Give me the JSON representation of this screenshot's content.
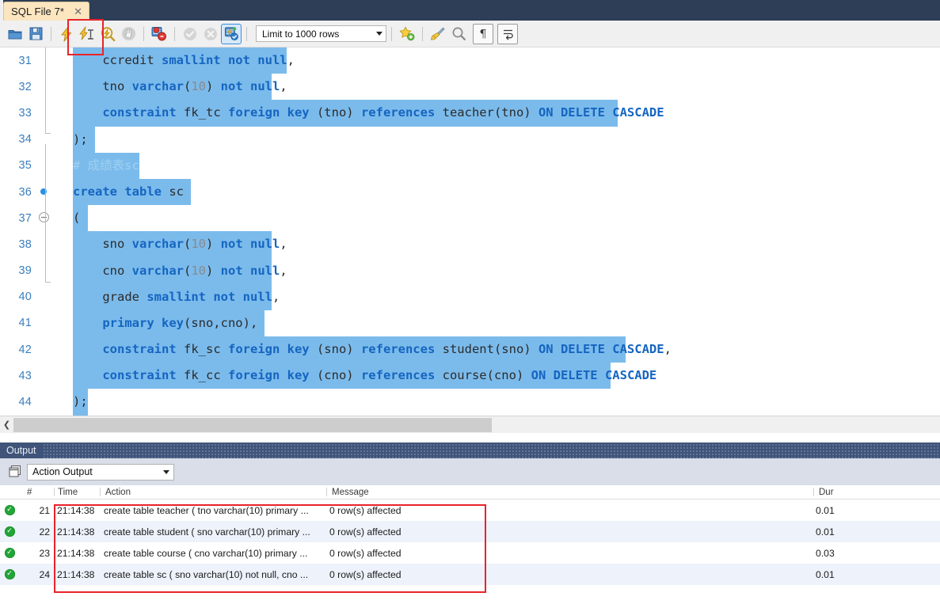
{
  "tab": {
    "label": "SQL File 7*",
    "close_icon": "close-icon"
  },
  "toolbar": {
    "items": [
      {
        "name": "open-sql-file-button",
        "icon": "folder-icon"
      },
      {
        "name": "save-sql-file-button",
        "icon": "floppy-disk-icon"
      },
      {
        "name": "execute-statement-button",
        "icon": "lightning-bolt-icon"
      },
      {
        "name": "execute-current-statement-button",
        "icon": "lightning-bolt-cursor-icon"
      },
      {
        "name": "explain-statement-button",
        "icon": "magnifier-lightning-icon"
      },
      {
        "name": "stop-execution-button",
        "icon": "stop-hand-icon"
      },
      {
        "name": "toggle-stop-on-error-button",
        "icon": "stop-on-error-icon"
      },
      {
        "name": "commit-button",
        "icon": "commit-check-icon"
      },
      {
        "name": "rollback-button",
        "icon": "rollback-cross-icon"
      },
      {
        "name": "toggle-autocommit-button",
        "icon": "autocommit-icon"
      },
      {
        "name": "beautify-query-button",
        "icon": "star-plus-icon"
      },
      {
        "name": "clear-query-button",
        "icon": "broom-icon"
      },
      {
        "name": "find-button",
        "icon": "magnifier-icon"
      },
      {
        "name": "toggle-invisible-chars-button",
        "icon": "pilcrow-icon"
      },
      {
        "name": "toggle-wrapping-button",
        "icon": "word-wrap-icon"
      }
    ],
    "limit_selector": {
      "label": "Limit to 1000 rows",
      "arrow_icon": "chevron-down-icon"
    }
  },
  "editor": {
    "lines": [
      {
        "num": "31",
        "indent": 4,
        "sel_start": 0,
        "sel_end": 29,
        "tokens": [
          {
            "t": "    ccredit ",
            "c": "plain"
          },
          {
            "t": "smallint not null",
            "c": "kw"
          },
          {
            "t": ",",
            "c": "plain"
          }
        ]
      },
      {
        "num": "32",
        "indent": 4,
        "sel_start": 0,
        "sel_end": 27,
        "tokens": [
          {
            "t": "    tno ",
            "c": "plain"
          },
          {
            "t": "varchar",
            "c": "kw"
          },
          {
            "t": "(",
            "c": "plain"
          },
          {
            "t": "10",
            "c": "num"
          },
          {
            "t": ") ",
            "c": "plain"
          },
          {
            "t": "not null",
            "c": "kw"
          },
          {
            "t": ",",
            "c": "plain"
          }
        ]
      },
      {
        "num": "33",
        "indent": 4,
        "sel_start": 0,
        "sel_end": 74,
        "tokens": [
          {
            "t": "    ",
            "c": "plain"
          },
          {
            "t": "constraint",
            "c": "kw"
          },
          {
            "t": " fk_tc ",
            "c": "plain"
          },
          {
            "t": "foreign key",
            "c": "kw"
          },
          {
            "t": " (tno) ",
            "c": "plain"
          },
          {
            "t": "references",
            "c": "kw"
          },
          {
            "t": " teacher(tno) ",
            "c": "plain"
          },
          {
            "t": "ON DELETE CASCADE",
            "c": "kw"
          }
        ]
      },
      {
        "num": "34",
        "indent": 0,
        "sel_start": 0,
        "sel_end": 3,
        "tokens": [
          {
            "t": ");",
            "c": "plain"
          }
        ]
      },
      {
        "num": "35",
        "indent": 0,
        "sel_start": 0,
        "sel_end": 9,
        "tokens": [
          {
            "t": "# 成绩表sc",
            "c": "cmt"
          }
        ]
      },
      {
        "num": "36",
        "indent": 0,
        "sel_start": 0,
        "sel_end": 16,
        "breakpoint": true,
        "tokens": [
          {
            "t": "create table",
            "c": "kw"
          },
          {
            "t": " sc",
            "c": "plain"
          }
        ]
      },
      {
        "num": "37",
        "indent": 0,
        "sel_start": 0,
        "sel_end": 2,
        "fold": true,
        "tokens": [
          {
            "t": "(",
            "c": "plain"
          }
        ]
      },
      {
        "num": "38",
        "indent": 4,
        "sel_start": 0,
        "sel_end": 27,
        "tokens": [
          {
            "t": "    sno ",
            "c": "plain"
          },
          {
            "t": "varchar",
            "c": "kw"
          },
          {
            "t": "(",
            "c": "plain"
          },
          {
            "t": "10",
            "c": "num"
          },
          {
            "t": ") ",
            "c": "plain"
          },
          {
            "t": "not null",
            "c": "kw"
          },
          {
            "t": ",",
            "c": "plain"
          }
        ]
      },
      {
        "num": "39",
        "indent": 4,
        "sel_start": 0,
        "sel_end": 27,
        "tokens": [
          {
            "t": "    cno ",
            "c": "plain"
          },
          {
            "t": "varchar",
            "c": "kw"
          },
          {
            "t": "(",
            "c": "plain"
          },
          {
            "t": "10",
            "c": "num"
          },
          {
            "t": ") ",
            "c": "plain"
          },
          {
            "t": "not null",
            "c": "kw"
          },
          {
            "t": ",",
            "c": "plain"
          }
        ]
      },
      {
        "num": "40",
        "indent": 4,
        "sel_start": 0,
        "sel_end": 27,
        "tokens": [
          {
            "t": "    grade ",
            "c": "plain"
          },
          {
            "t": "smallint not null",
            "c": "kw"
          },
          {
            "t": ",",
            "c": "plain"
          }
        ]
      },
      {
        "num": "41",
        "indent": 4,
        "sel_start": 0,
        "sel_end": 26,
        "tokens": [
          {
            "t": "    ",
            "c": "plain"
          },
          {
            "t": "primary key",
            "c": "kw"
          },
          {
            "t": "(sno,cno),",
            "c": "plain"
          }
        ]
      },
      {
        "num": "42",
        "indent": 4,
        "sel_start": 0,
        "sel_end": 75,
        "tokens": [
          {
            "t": "    ",
            "c": "plain"
          },
          {
            "t": "constraint",
            "c": "kw"
          },
          {
            "t": " fk_sc ",
            "c": "plain"
          },
          {
            "t": "foreign key",
            "c": "kw"
          },
          {
            "t": " (sno) ",
            "c": "plain"
          },
          {
            "t": "references",
            "c": "kw"
          },
          {
            "t": " student(sno) ",
            "c": "plain"
          },
          {
            "t": "ON DELETE CASCADE",
            "c": "kw"
          },
          {
            "t": ",",
            "c": "plain"
          }
        ]
      },
      {
        "num": "43",
        "indent": 4,
        "sel_start": 0,
        "sel_end": 73,
        "tokens": [
          {
            "t": "    ",
            "c": "plain"
          },
          {
            "t": "constraint",
            "c": "kw"
          },
          {
            "t": " fk_cc ",
            "c": "plain"
          },
          {
            "t": "foreign key",
            "c": "kw"
          },
          {
            "t": " (cno) ",
            "c": "plain"
          },
          {
            "t": "references",
            "c": "kw"
          },
          {
            "t": " course(cno) ",
            "c": "plain"
          },
          {
            "t": "ON DELETE CASCADE",
            "c": "kw"
          }
        ]
      },
      {
        "num": "44",
        "indent": 0,
        "sel_start": 0,
        "sel_end": 2,
        "tokens": [
          {
            "t": ");",
            "c": "plain"
          }
        ]
      }
    ]
  },
  "output_panel": {
    "title": "Output",
    "view_selector": {
      "label": "Action Output",
      "arrow_icon": "chevron-down-icon"
    },
    "columns": [
      "",
      "#",
      "Time",
      "Action",
      "Message",
      "Dur"
    ],
    "rows": [
      {
        "status": "success",
        "num": "21",
        "time": "21:14:38",
        "action": "create table teacher ( tno varchar(10) primary ...",
        "message": "0 row(s) affected",
        "duration": "0.01"
      },
      {
        "status": "success",
        "num": "22",
        "time": "21:14:38",
        "action": "create table student ( sno varchar(10) primary ...",
        "message": "0 row(s) affected",
        "duration": "0.01"
      },
      {
        "status": "success",
        "num": "23",
        "time": "21:14:38",
        "action": "create table course ( cno varchar(10) primary ...",
        "message": "0 row(s) affected",
        "duration": "0.03"
      },
      {
        "status": "success",
        "num": "24",
        "time": "21:14:38",
        "action": "create table sc ( sno varchar(10) not null, cno ...",
        "message": "0 row(s) affected",
        "duration": "0.01"
      }
    ]
  },
  "annotations": {
    "accent_color": "#e8232a",
    "boxes": [
      {
        "name": "execute-button-highlight"
      },
      {
        "name": "output-rows-highlight"
      }
    ]
  },
  "colors": {
    "selection": "#7bbbec",
    "keyword": "#1565c0",
    "comment": "#9fd0f0",
    "gutter_number": "#3a7fbd",
    "panel_header": "#3f5478",
    "tab_active": "#fbe6c0"
  }
}
